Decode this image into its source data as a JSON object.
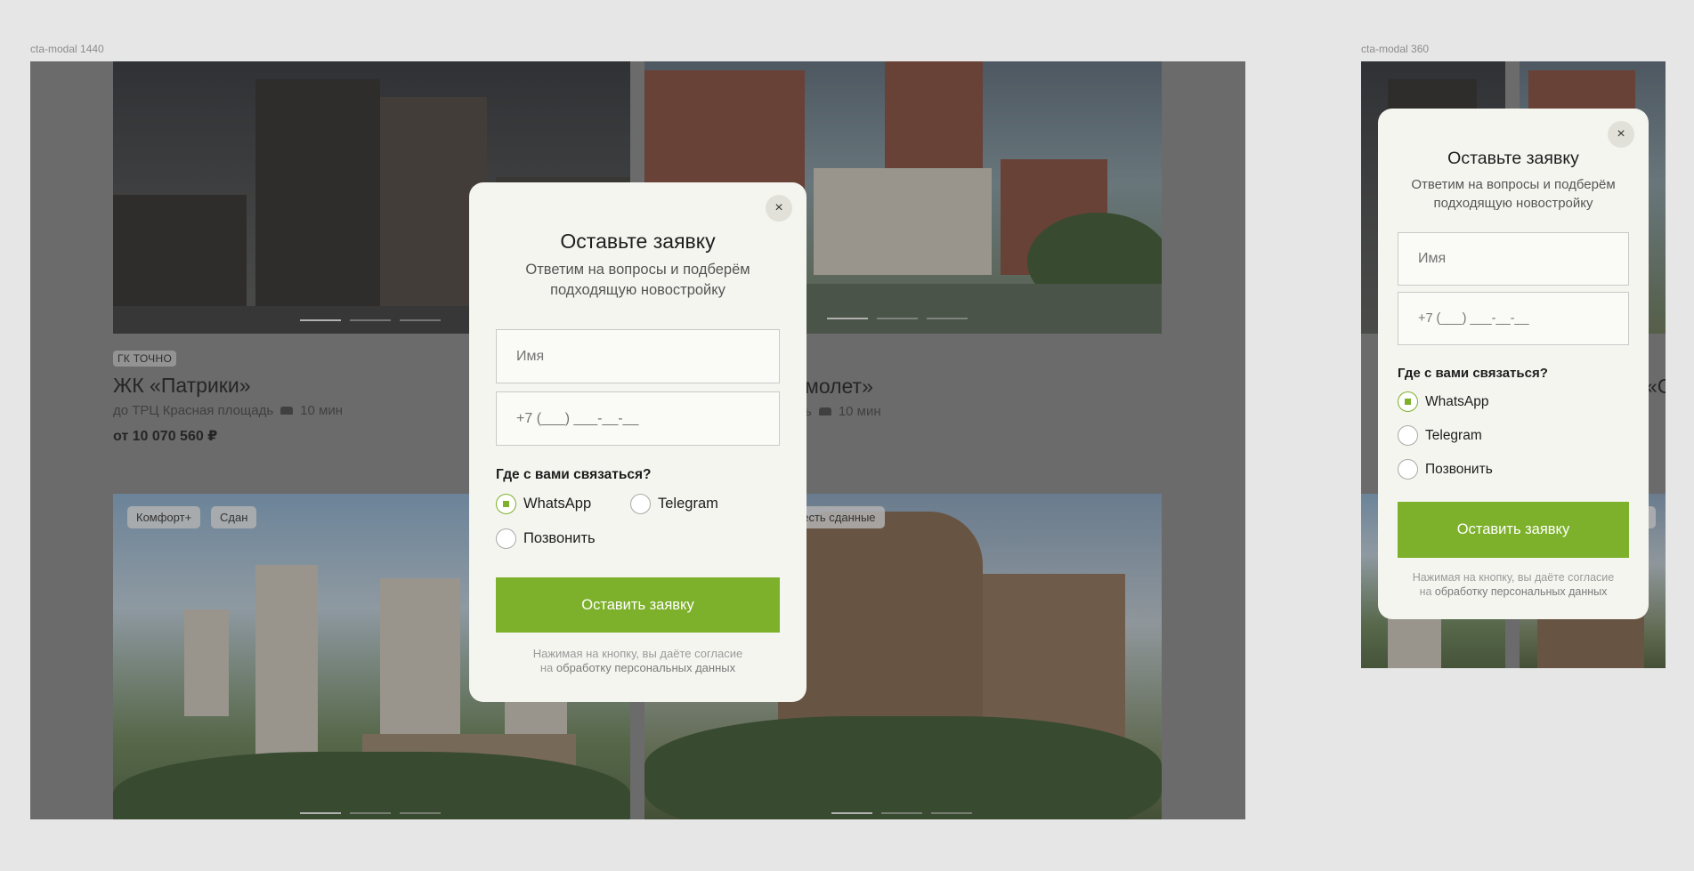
{
  "frames": {
    "desktop_label": "cta-modal 1440",
    "mobile_label": "cta-modal 360"
  },
  "listing": {
    "card1": {
      "tag": "ГК ТОЧНО",
      "title": "ЖК «Патрики»",
      "location": "до ТРЦ Красная площадь",
      "drive": "10 мин",
      "price": "от 10 070 560 ₽"
    },
    "card2": {
      "title_visible": "молет»",
      "location_visible": "ь",
      "drive": "10 мин"
    },
    "card3": {
      "badge_comfort": "Комфорт+",
      "badge_done": "Сдан"
    },
    "card4": {
      "badge_visible": ", есть сданные"
    },
    "mobile": {
      "title_visible": "«С",
      "badge_visible": "ит"
    }
  },
  "modal": {
    "close_symbol": "×",
    "title": "Оставьте заявку",
    "subtitle_line1": "Ответим на вопросы и подберём",
    "subtitle_line2": "подходящую новостройку",
    "name_placeholder": "Имя",
    "phone_placeholder": "+7 (___) ___-__-__",
    "question": "Где с вами связаться?",
    "options": [
      {
        "label": "WhatsApp",
        "selected": true
      },
      {
        "label": "Telegram",
        "selected": false
      },
      {
        "label": "Позвонить",
        "selected": false
      }
    ],
    "submit_label": "Оставить заявку",
    "consent_line1": "Нажимая на кнопку, вы даёте согласие",
    "consent_prefix": "на ",
    "consent_link": "обработку персональных данных"
  },
  "colors": {
    "accent": "#7db12b",
    "modal_bg": "#f5f5f0",
    "page_bg": "#e6e6e6"
  }
}
